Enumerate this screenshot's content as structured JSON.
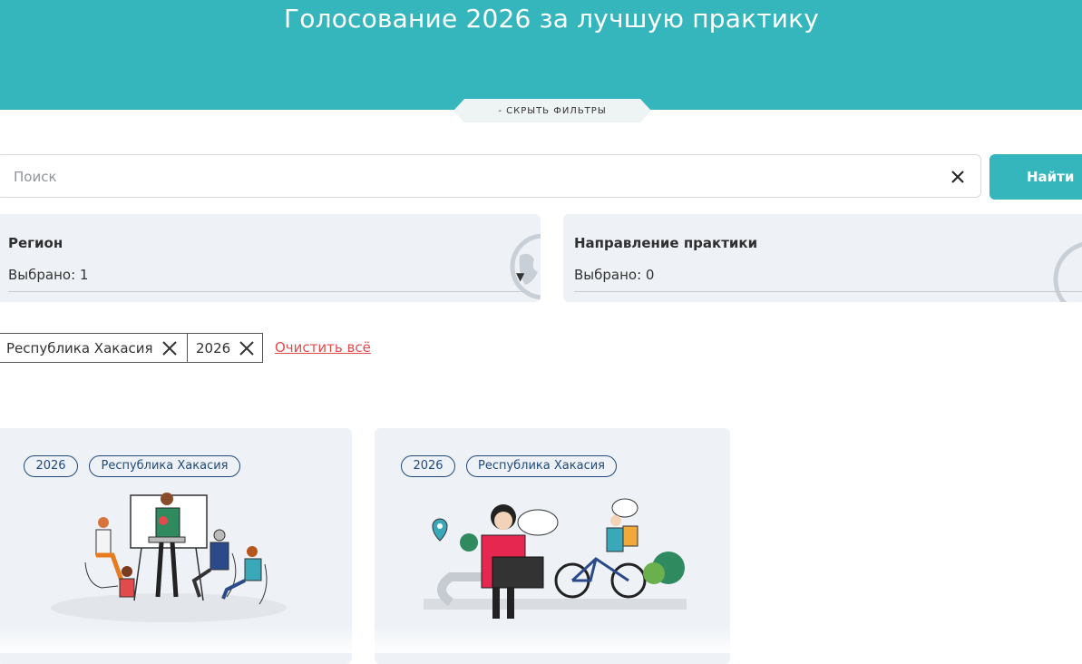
{
  "header": {
    "title": "Голосование 2026 за лучшую практику",
    "filter_toggle_label": "- СКРЫТЬ ФИЛЬТРЫ"
  },
  "search": {
    "placeholder": "Поиск",
    "value": "",
    "submit_label": "Найти"
  },
  "filters": {
    "region": {
      "label": "Регион",
      "value": "Выбрано: 1"
    },
    "direction": {
      "label": "Направление практики",
      "value": "Выбрано: 0"
    }
  },
  "active_chips": [
    {
      "label": "Республика Хакасия"
    },
    {
      "label": "2026"
    }
  ],
  "clear_all_label": "Очистить всё",
  "cards": [
    {
      "tags": [
        "2026",
        "Республика Хакасия"
      ],
      "illustration": "group-meeting-illustration"
    },
    {
      "tags": [
        "2026",
        "Республика Хакасия"
      ],
      "illustration": "courier-laptop-illustration"
    }
  ],
  "colors": {
    "brand_teal": "#34b6bc",
    "card_bg": "#eef2f7",
    "link_red": "#e14b4b",
    "tag_blue": "#1f4a7a"
  }
}
